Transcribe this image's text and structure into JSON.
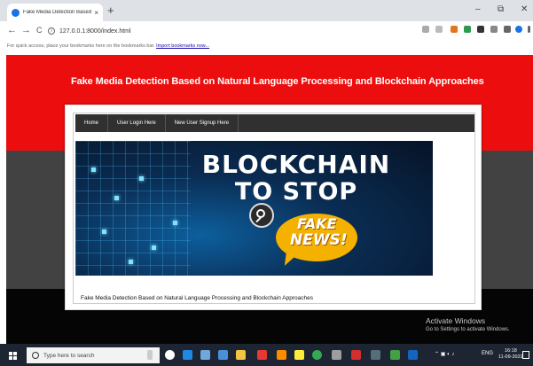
{
  "browser": {
    "tab_title": "Fake Media Detection Based on",
    "tab_close": "×",
    "new_tab": "+",
    "win_min": "–",
    "win_max": "⧉",
    "win_close": "✕",
    "back": "←",
    "forward": "→",
    "reload": "C",
    "url": "127.0.0.1:8000/index.html",
    "bookmarks_hint": "For quick access, place your bookmarks here on the bookmarks bar.",
    "bookmarks_link": "Import bookmarks now..."
  },
  "site": {
    "title": "Fake Media Detection Based on Natural Language Processing and Blockchain Approaches",
    "menu": [
      "Home",
      "User Login Here",
      "New User Signup Here"
    ],
    "hero": {
      "line1": "BLOCKCHAIN",
      "line2": "TO STOP",
      "fake": "FAKE",
      "news": "NEWS!"
    },
    "caption": "Fake Media Detection Based on Natural Language Processing and Blockchain Approaches"
  },
  "watermark": {
    "title": "Activate Windows",
    "subtitle": "Go to Settings to activate Windows."
  },
  "taskbar": {
    "search_placeholder": "Type here to search",
    "tray_text": "ENG",
    "time": "16:18",
    "date": "11-09-2022"
  },
  "colors": {
    "header_red": "#ec0e0e",
    "band_gray": "#424242",
    "menu_bg": "#303030",
    "taskbar": "#1c2531"
  }
}
